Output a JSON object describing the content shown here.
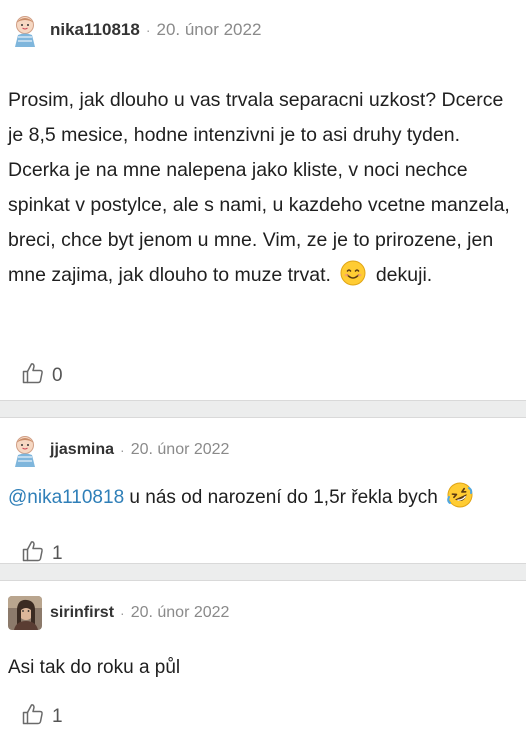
{
  "posts": [
    {
      "username": "nika110818",
      "date": "20. únor 2022",
      "text_before_emoji": "Prosim, jak dlouho u vas trvala separacni uzkost? Dcerce je 8,5 mesice, hodne intenzivni je to asi druhy tyden. Dcerka je na mne nalepena jako kliste, v noci nechce spinkat v postylce, ale s nami, u kazdeho vcetne manzela, breci, chce byt jenom u mne. Vim, ze je to prirozene, jen mne zajima, jak dlouho to muze trvat.",
      "text_after_emoji": "dekuji.",
      "emoji": "smiling-face-icon",
      "likes": "0"
    },
    {
      "username": "jjasmina",
      "date": "20. únor 2022",
      "mention": "@nika110818",
      "text": "u nás od narození do 1,5r řekla bych",
      "emoji": "rolling-laughing-face-icon",
      "likes": "1"
    },
    {
      "username": "sirinfirst",
      "date": "20. únor 2022",
      "text": "Asi tak do roku a půl",
      "likes": "1"
    }
  ],
  "separator": "·",
  "colors": {
    "mention": "#2f7fb8",
    "meta": "#8a8a8a",
    "separator_bg": "#eceded"
  }
}
